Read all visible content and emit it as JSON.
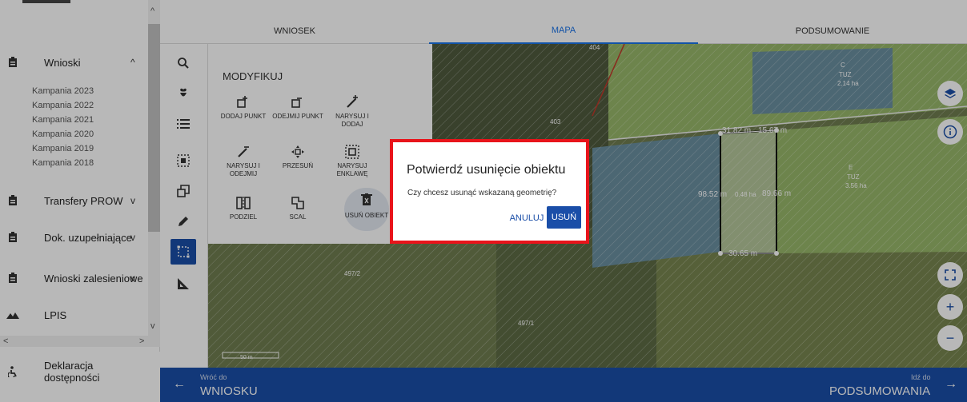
{
  "sidebar": {
    "sections": [
      {
        "label": "Wnioski",
        "icon": "document-icon",
        "chevron": "^"
      },
      {
        "label": "Transfery PROW",
        "icon": "document-icon",
        "chevron": "v"
      },
      {
        "label": "Dok. uzupełniające",
        "icon": "document-icon",
        "chevron": "v"
      },
      {
        "label": "Wnioski zalesieniowe",
        "icon": "document-icon",
        "chevron": "v"
      },
      {
        "label": "LPIS",
        "icon": "mountain-icon",
        "chevron": ""
      }
    ],
    "campaigns": [
      "Kampania 2023",
      "Kampania 2022",
      "Kampania 2021",
      "Kampania 2020",
      "Kampania 2019",
      "Kampania 2018"
    ],
    "accessibility": "Deklaracja dostępności"
  },
  "tabs": [
    "WNIOSEK",
    "MAPA",
    "PODSUMOWANIE"
  ],
  "active_tab": "MAPA",
  "panel": {
    "title": "MODYFIKUJ",
    "buttons": [
      "DODAJ PUNKT",
      "ODEJMIJ PUNKT",
      "NARYSUJ I DODAJ",
      "NARYSUJ I ODEJMIJ",
      "PRZESUŃ",
      "NARYSUJ ENKLAWĘ",
      "PODZIEL",
      "SCAL",
      "USUŃ OBIEKT"
    ]
  },
  "map": {
    "labels": [
      "404",
      "403",
      "497/2",
      "497/1",
      "C",
      "TUZ",
      "2.14 ha",
      "E",
      "TUZ",
      "3.56 ha",
      "31.82 m",
      "15.67 m",
      "98.52 m",
      "0.48 ha",
      "89.66 m",
      "30.65 m"
    ],
    "scale": "50 m"
  },
  "dialog": {
    "title": "Potwierdź usunięcie obiektu",
    "text": "Czy chcesz usunąć wskazaną geometrię?",
    "cancel": "ANULUJ",
    "confirm": "USUŃ"
  },
  "bottom": {
    "back_small": "Wróć do",
    "back_big": "WNIOSKU",
    "next_small": "Idź do",
    "next_big": "PODSUMOWANIA"
  },
  "colors": {
    "primary": "#1a4ea8",
    "dialog_border": "#e8141b"
  }
}
